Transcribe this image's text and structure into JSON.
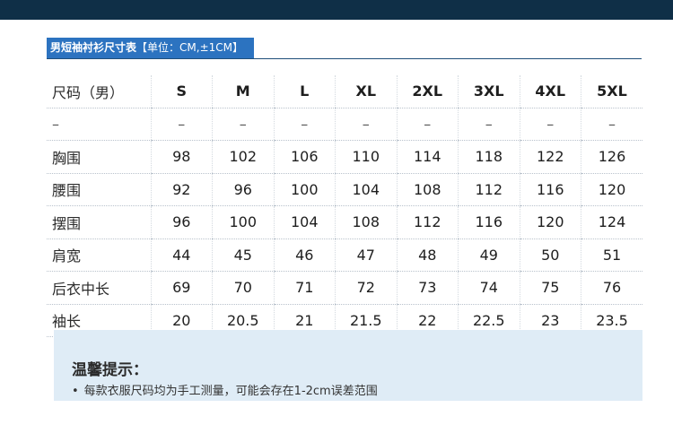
{
  "title": {
    "name": "男短袖衬衫尺寸表",
    "unit": "【单位：CM,±1CM】"
  },
  "table": {
    "header_label": "尺码（男）",
    "sizes": [
      "S",
      "M",
      "L",
      "XL",
      "2XL",
      "3XL",
      "4XL",
      "5XL"
    ],
    "rows": [
      {
        "label": "–",
        "values": [
          "–",
          "–",
          "–",
          "–",
          "–",
          "–",
          "–",
          "–"
        ]
      },
      {
        "label": "胸围",
        "values": [
          "98",
          "102",
          "106",
          "110",
          "114",
          "118",
          "122",
          "126"
        ]
      },
      {
        "label": "腰围",
        "values": [
          "92",
          "96",
          "100",
          "104",
          "108",
          "112",
          "116",
          "120"
        ]
      },
      {
        "label": "摆围",
        "values": [
          "96",
          "100",
          "104",
          "108",
          "112",
          "116",
          "120",
          "124"
        ]
      },
      {
        "label": "肩宽",
        "values": [
          "44",
          "45",
          "46",
          "47",
          "48",
          "49",
          "50",
          "51"
        ]
      },
      {
        "label": "后衣中长",
        "values": [
          "69",
          "70",
          "71",
          "72",
          "73",
          "74",
          "75",
          "76"
        ]
      },
      {
        "label": "袖长",
        "values": [
          "20",
          "20.5",
          "21",
          "21.5",
          "22",
          "22.5",
          "23",
          "23.5"
        ]
      }
    ]
  },
  "tips": {
    "title": "温馨提示：",
    "items": [
      "每款衣服尺码均为手工测量，可能会存在1-2cm误差范围"
    ]
  }
}
